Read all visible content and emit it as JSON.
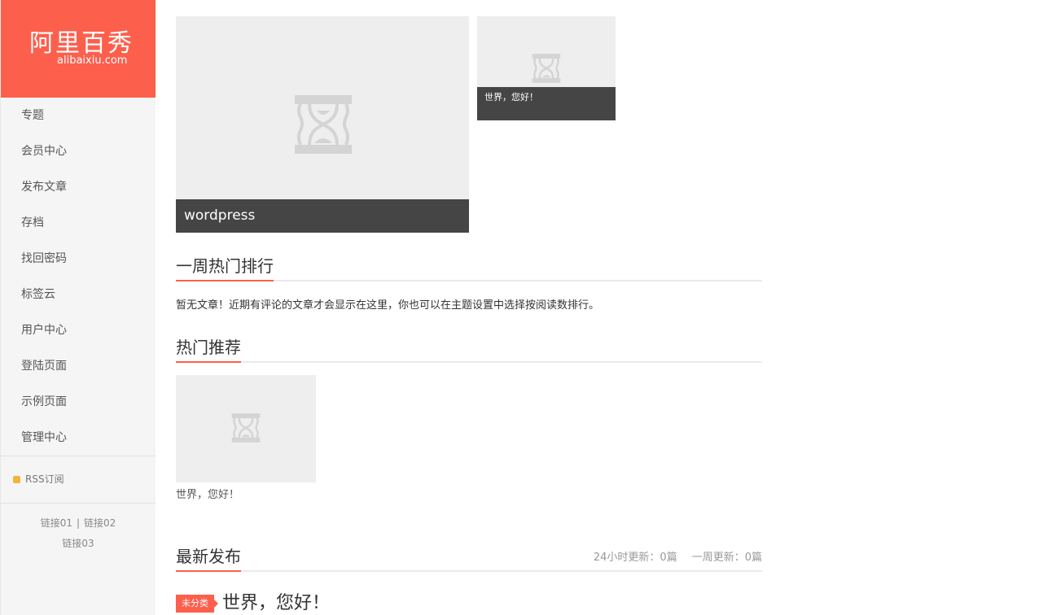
{
  "logo": {
    "name_cn": "阿里百秀",
    "domain": "alibaixiu.com"
  },
  "nav": [
    {
      "label": "专题"
    },
    {
      "label": "会员中心"
    },
    {
      "label": "发布文章"
    },
    {
      "label": "存档"
    },
    {
      "label": "找回密码"
    },
    {
      "label": "标签云"
    },
    {
      "label": "用户中心"
    },
    {
      "label": "登陆页面"
    },
    {
      "label": "示例页面"
    },
    {
      "label": "管理中心"
    }
  ],
  "rss": {
    "label": "RSS订阅",
    "icon": "rss-square-icon"
  },
  "links": {
    "link1": "链接01",
    "separator": "|",
    "link2": "链接02",
    "link3": "链接03"
  },
  "slider": {
    "main": {
      "caption": "wordpress",
      "icon": "hourglass-placeholder-icon"
    },
    "side": {
      "caption": "世界，您好！",
      "icon": "hourglass-placeholder-icon"
    }
  },
  "weekly_hot": {
    "title": "一周热门排行",
    "note": "暂无文章！近期有评论的文章才会显示在这里，你也可以在主题设置中选择按阅读数排行。"
  },
  "recommended": {
    "title": "热门推荐",
    "items": [
      {
        "title": "世界，您好！",
        "icon": "hourglass-placeholder-icon"
      }
    ]
  },
  "latest": {
    "title": "最新发布",
    "stat_24h": "24小时更新：0篇",
    "stat_week": "一周更新：0篇",
    "posts": [
      {
        "category": "未分类",
        "title": "世界，您好！"
      }
    ]
  },
  "colors": {
    "accent": "#fd5f4d",
    "caption_bg": "#454545",
    "placeholder_bg": "#eeeeee",
    "rss": "#f0b53a"
  }
}
